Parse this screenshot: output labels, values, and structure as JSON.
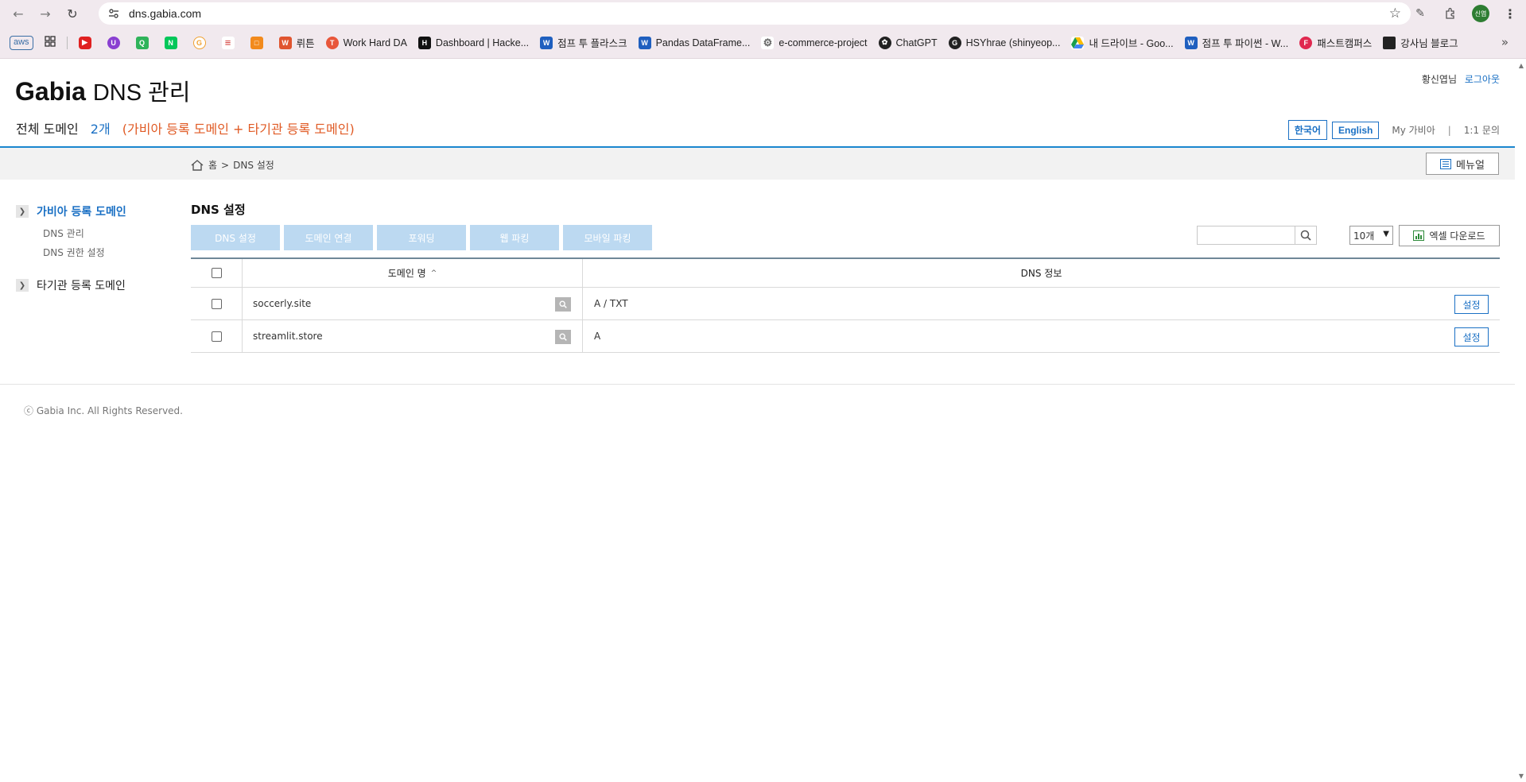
{
  "browser": {
    "url": "dns.gabia.com",
    "profile_initials": "신엽",
    "bookmarks": [
      {
        "label": "aws",
        "icon": "aws-icon"
      },
      {
        "label": "",
        "icon": "apps-grid-icon"
      },
      {
        "label": "",
        "icon": "youtube-icon",
        "color": "#e02020"
      },
      {
        "label": "",
        "icon": "purple-app-icon",
        "color": "#8a3fd1"
      },
      {
        "label": "",
        "icon": "green-app-icon",
        "color": "#2fb35a"
      },
      {
        "label": "",
        "icon": "naver-icon",
        "color": "#03c75a"
      },
      {
        "label": "",
        "icon": "orange-circle-icon",
        "color": "#f0a030"
      },
      {
        "label": "",
        "icon": "layers-icon",
        "color": "#d0322d"
      },
      {
        "label": "",
        "icon": "box-icon",
        "color": "#f28a1c"
      },
      {
        "label": "뤼튼",
        "icon": "wrtn-icon",
        "color": "#e0542f"
      },
      {
        "label": "Work Hard DA",
        "icon": "work-hard-icon",
        "color": "#e8563a"
      },
      {
        "label": "Dashboard | Hacke...",
        "icon": "hackerrank-icon",
        "color": "#111111"
      },
      {
        "label": "점프 투 플라스크",
        "icon": "wikidocs-icon",
        "color": "#1f5fbf"
      },
      {
        "label": "Pandas DataFrame...",
        "icon": "wikidocs-icon",
        "color": "#1f5fbf"
      },
      {
        "label": "e-commerce-project",
        "icon": "gear-icon",
        "color": "#666666"
      },
      {
        "label": "ChatGPT",
        "icon": "chatgpt-icon",
        "color": "#222222"
      },
      {
        "label": "HSYhrae (shinyeop...",
        "icon": "github-icon",
        "color": "#222222"
      },
      {
        "label": "내 드라이브 - Goo...",
        "icon": "google-drive-icon",
        "color": "#1a9e4b"
      },
      {
        "label": "점프 투 파이썬 - W...",
        "icon": "wikidocs-icon",
        "color": "#1f5fbf"
      },
      {
        "label": "패스트캠퍼스",
        "icon": "fastcampus-icon",
        "color": "#e0284f"
      },
      {
        "label": "강사님 블로그",
        "icon": "blog-icon",
        "color": "#222222"
      }
    ]
  },
  "header": {
    "brand": "Gabia",
    "title_suffix": "DNS 관리",
    "user_name": "황신엽님",
    "logout": "로그아웃",
    "summary_label": "전체 도메인",
    "summary_count": "2개",
    "summary_desc": "(가비아 등록 도메인 + 타기관 등록 도메인)",
    "lang_ko": "한국어",
    "lang_en": "English",
    "my_gabia": "My 가비아",
    "separator": "|",
    "inquiry": "1:1 문의"
  },
  "breadcrumb": {
    "home": "홈",
    "sep": ">",
    "current": "DNS 설정"
  },
  "menu_button": "메뉴얼",
  "sidebar": {
    "groups": [
      {
        "label": "가비아 등록 도메인",
        "items": [
          "DNS 관리",
          "DNS 권한 설정"
        ]
      },
      {
        "label": "타기관 등록 도메인",
        "items": []
      }
    ]
  },
  "main": {
    "title": "DNS 설정",
    "tabs": [
      "DNS 설정",
      "도메인 연결",
      "포워딩",
      "웹 파킹",
      "모바일 파킹"
    ],
    "page_size": "10개",
    "excel_button": "엑셀 다운로드",
    "columns": {
      "domain": "도메인 명",
      "sort_indicator": "^",
      "dns_info": "DNS 정보"
    },
    "rows": [
      {
        "domain": "soccerly.site",
        "dns_info": "A / TXT",
        "action": "설정"
      },
      {
        "domain": "streamlit.store",
        "dns_info": "A",
        "action": "설정"
      }
    ]
  },
  "footer": {
    "copyright": "ⓒ Gabia Inc. All Rights Reserved."
  },
  "colors": {
    "accent": "#1a70c4",
    "summary_desc": "#e05a24",
    "tab_disabled": "#bcd9f1",
    "rule": "#1a86cf"
  }
}
